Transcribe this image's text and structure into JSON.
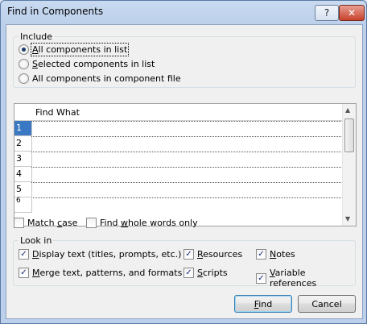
{
  "window": {
    "title": "Find in Components",
    "help_label": "?",
    "close_label": "✕"
  },
  "include": {
    "label": "Include",
    "options": [
      {
        "pre": "",
        "u": "A",
        "post": "ll components in list",
        "selected": true
      },
      {
        "pre": "",
        "u": "S",
        "post": "elected components in list",
        "selected": false
      },
      {
        "pre": "All components in component file",
        "u": "",
        "post": "",
        "selected": false
      }
    ]
  },
  "grid": {
    "header": "Find What",
    "rows": [
      "1",
      "2",
      "3",
      "4",
      "5",
      "6"
    ],
    "scroll_up": "▲",
    "scroll_down": "▼"
  },
  "options": {
    "match_case": {
      "pre": "Match ",
      "u": "c",
      "post": "ase",
      "checked": false
    },
    "whole_words": {
      "pre": "Find ",
      "u": "w",
      "post": "hole words only",
      "checked": false
    }
  },
  "look_in": {
    "label": "Look in",
    "items": [
      {
        "pre": "",
        "u": "D",
        "post": "isplay text (titles, prompts, etc.)",
        "checked": true
      },
      {
        "pre": "",
        "u": "R",
        "post": "esources",
        "checked": true
      },
      {
        "pre": "",
        "u": "N",
        "post": "otes",
        "checked": true
      },
      {
        "pre": "",
        "u": "M",
        "post": "erge text, patterns, and formats",
        "checked": true
      },
      {
        "pre": "",
        "u": "S",
        "post": "cripts",
        "checked": true
      },
      {
        "pre": "",
        "u": "V",
        "post": "ariable references",
        "checked": true
      }
    ],
    "check_glyph": "✓"
  },
  "buttons": {
    "find": {
      "pre": "",
      "u": "F",
      "post": "ind"
    },
    "cancel": "Cancel"
  }
}
